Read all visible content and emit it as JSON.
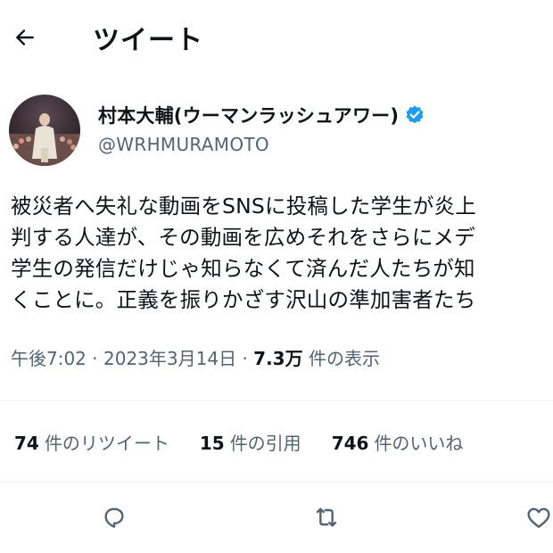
{
  "header": {
    "title": "ツイート"
  },
  "user": {
    "display_name": "村本大輔(ウーマンラッシュアワー)",
    "handle": "@WRHMURAMOTO"
  },
  "tweet": {
    "lines": [
      "被災者へ失礼な動画をSNSに投稿した学生が炎上",
      "判する人達が、その動画を広めそれをさらにメデ",
      "学生の発信だけじゃ知らなくて済んだ人たちが知",
      "くことに。正義を振りかざす沢山の準加害者たち"
    ],
    "time": "午後7:02",
    "date": "2023年3月14日",
    "views_count": "7.3万",
    "views_label": "件の表示"
  },
  "stats": {
    "retweets": {
      "count": "74",
      "label": "件のリツイート"
    },
    "quotes": {
      "count": "15",
      "label": "件の引用"
    },
    "likes": {
      "count": "746",
      "label": "件のいいね"
    }
  },
  "colors": {
    "accent": "#1d9bf0",
    "secondary_text": "#536471",
    "text": "#0f1419"
  },
  "icons": [
    "back-arrow-icon",
    "verified-badge-icon",
    "reply-icon",
    "retweet-icon",
    "like-icon"
  ]
}
